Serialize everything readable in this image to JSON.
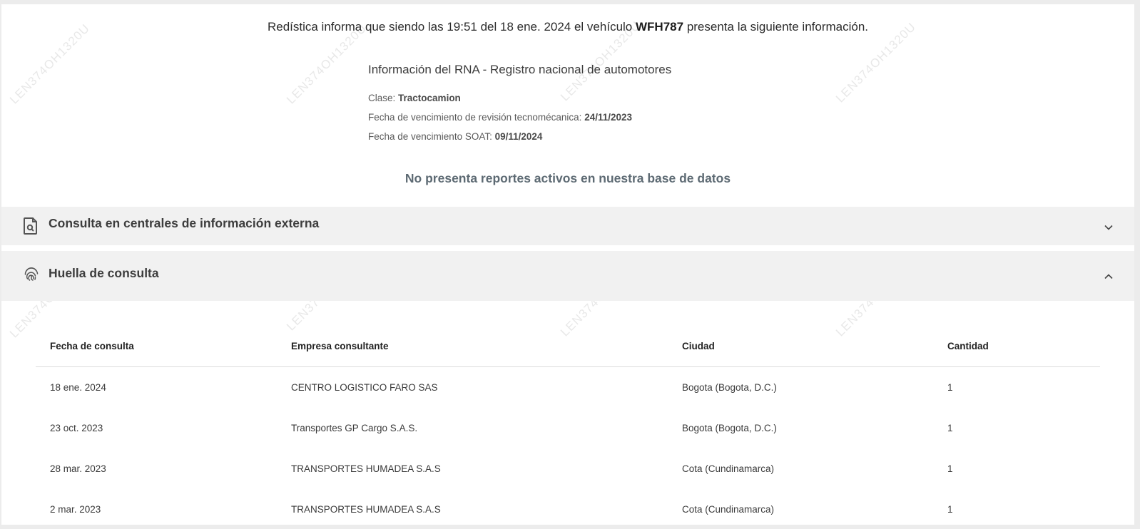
{
  "headline": {
    "prefix": "Redística informa que siendo las 19:51 del 18 ene. 2024 el vehículo",
    "plate": "WFH787",
    "suffix": "presenta la siguiente información."
  },
  "rna": {
    "title": "Información del RNA - Registro nacional de automotores",
    "clase_label": "Clase:",
    "clase_value": "Tractocamion",
    "tecno_label": "Fecha de vencimiento de revisión tecnomécanica:",
    "tecno_value": "24/11/2023",
    "soat_label": "Fecha de vencimiento SOAT:",
    "soat_value": "09/11/2024"
  },
  "no_reports": "No presenta reportes activos en nuestra base de datos",
  "sections": {
    "external": {
      "title": "Consulta en centrales de información externa",
      "icon": "document-search-icon",
      "expanded": false
    },
    "footprint": {
      "title": "Huella de consulta",
      "icon": "fingerprint-icon",
      "expanded": true
    }
  },
  "table": {
    "headers": [
      "Fecha de consulta",
      "Empresa consultante",
      "Ciudad",
      "Cantidad"
    ],
    "rows": [
      [
        "18 ene. 2024",
        "CENTRO LOGISTICO FARO SAS",
        "Bogota (Bogota, D.C.)",
        "1"
      ],
      [
        "23 oct. 2023",
        "Transportes GP Cargo S.A.S.",
        "Bogota (Bogota, D.C.)",
        "1"
      ],
      [
        "28 mar. 2023",
        "TRANSPORTES HUMADEA S.A.S",
        "Cota (Cundinamarca)",
        "1"
      ],
      [
        "2 mar. 2023",
        "TRANSPORTES HUMADEA S.A.S",
        "Cota (Cundinamarca)",
        "1"
      ]
    ]
  },
  "watermark": "LEN374OH1320U"
}
